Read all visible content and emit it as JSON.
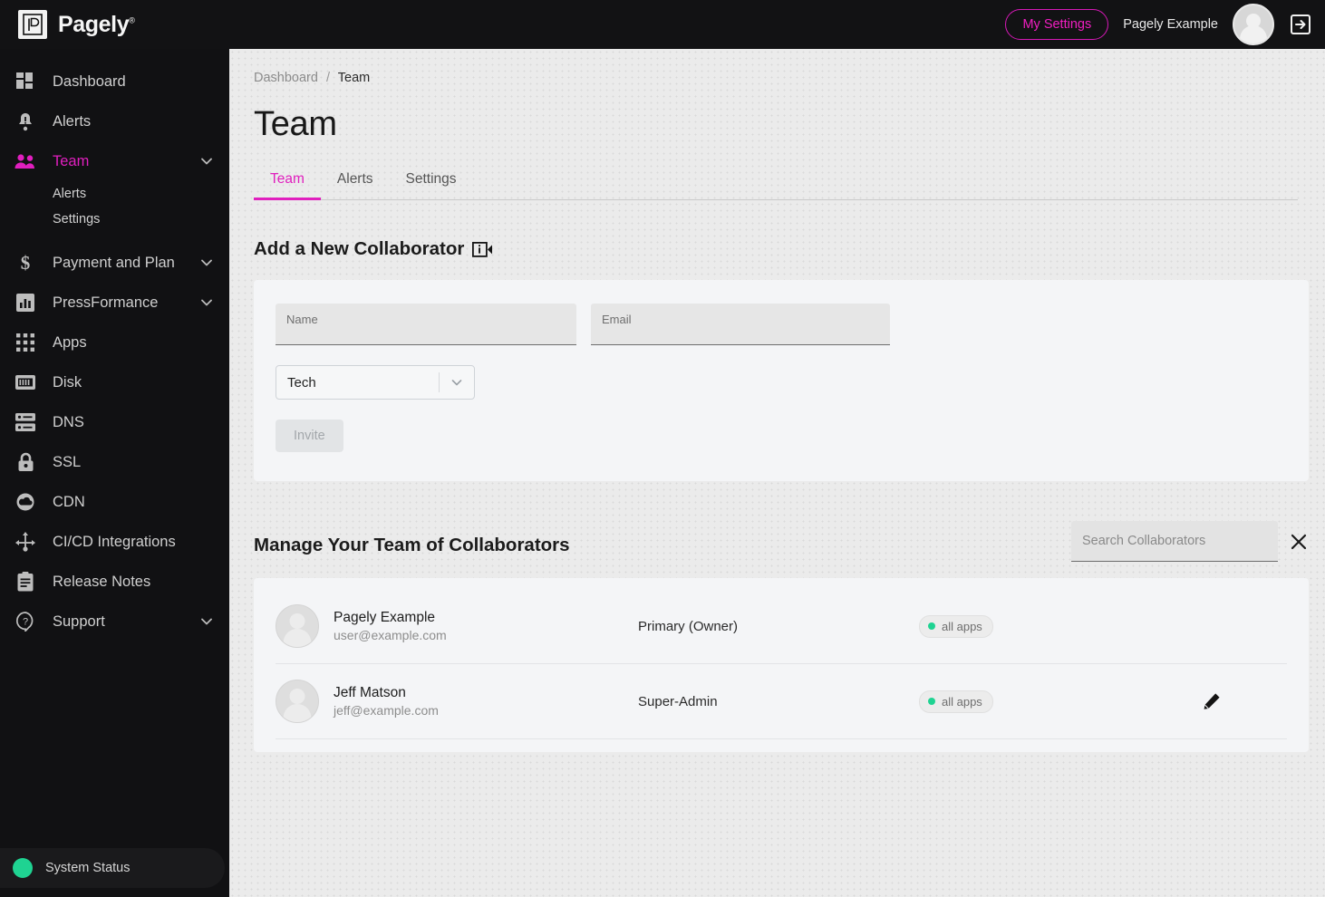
{
  "topbar": {
    "brand_name": "Pagely",
    "brand_reg": "®",
    "my_settings_label": "My Settings",
    "account_name": "Pagely Example"
  },
  "sidebar": {
    "items": [
      {
        "label": "Dashboard",
        "icon": "dashboard-icon",
        "expandable": false,
        "active": false
      },
      {
        "label": "Alerts",
        "icon": "bell-icon",
        "expandable": false,
        "active": false
      },
      {
        "label": "Team",
        "icon": "people-icon",
        "expandable": true,
        "active": true
      },
      {
        "label": "Payment and Plan",
        "icon": "dollar-icon",
        "expandable": true,
        "active": false
      },
      {
        "label": "PressFormance",
        "icon": "bar-chart-icon",
        "expandable": true,
        "active": false
      },
      {
        "label": "Apps",
        "icon": "grid-icon",
        "expandable": false,
        "active": false
      },
      {
        "label": "Disk",
        "icon": "disk-icon",
        "expandable": false,
        "active": false
      },
      {
        "label": "DNS",
        "icon": "server-icon",
        "expandable": false,
        "active": false
      },
      {
        "label": "SSL",
        "icon": "lock-icon",
        "expandable": false,
        "active": false
      },
      {
        "label": "CDN",
        "icon": "cloud-icon",
        "expandable": false,
        "active": false
      },
      {
        "label": "CI/CD Integrations",
        "icon": "integrations-icon",
        "expandable": false,
        "active": false
      },
      {
        "label": "Release Notes",
        "icon": "clipboard-icon",
        "expandable": false,
        "active": false
      },
      {
        "label": "Support",
        "icon": "question-icon",
        "expandable": true,
        "active": false
      }
    ],
    "team_submenu": [
      {
        "label": "Alerts"
      },
      {
        "label": "Settings"
      }
    ],
    "system_status_label": "System Status",
    "system_status_color": "#1fd392"
  },
  "breadcrumb": {
    "root": "Dashboard",
    "separator": "/",
    "current": "Team"
  },
  "page": {
    "title": "Team"
  },
  "tabs": [
    {
      "label": "Team",
      "active": true
    },
    {
      "label": "Alerts",
      "active": false
    },
    {
      "label": "Settings",
      "active": false
    }
  ],
  "invite": {
    "section_title": "Add a New Collaborator",
    "info_icon": "info-tooltip-icon",
    "name_field": {
      "label": "Name",
      "value": "",
      "placeholder": ""
    },
    "email_field": {
      "label": "Email",
      "value": "",
      "placeholder": ""
    },
    "role_select": {
      "value": "Tech"
    },
    "invite_button": "Invite"
  },
  "manage": {
    "title": "Manage Your Team of Collaborators",
    "search_placeholder": "Search Collaborators",
    "search_value": "",
    "clear_icon": "close-icon",
    "rows": [
      {
        "name": "Pagely Example",
        "email": "user@example.com",
        "role": "Primary (Owner)",
        "apps": "all apps",
        "apps_dot_color": "#1fd392",
        "editable": false
      },
      {
        "name": "Jeff Matson",
        "email": "jeff@example.com",
        "role": "Super-Admin",
        "apps": "all apps",
        "apps_dot_color": "#1fd392",
        "editable": true
      }
    ]
  },
  "colors": {
    "accent": "#e01fbe",
    "sidebar_bg": "#111113",
    "page_bg": "#ebebeb",
    "card_bg": "#f4f5f7",
    "status_green": "#1fd392"
  }
}
